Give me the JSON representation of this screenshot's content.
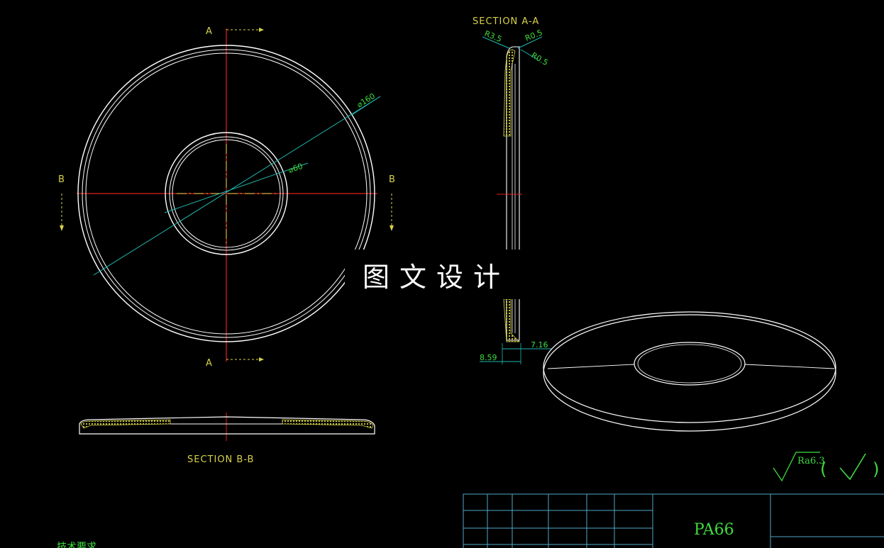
{
  "views": {
    "front": {
      "section_mark_top": "A",
      "section_mark_bottom": "A",
      "section_mark_left": "B",
      "section_mark_right": "B",
      "outer_diameter": "⌀160",
      "inner_diameter": "⌀60"
    },
    "section_bb": {
      "title": "SECTION B-B"
    },
    "section_aa": {
      "title": "SECTION A-A",
      "radius_1": "R3.5",
      "radius_2": "R0.5",
      "radius_3": "R0.5",
      "dim_1": "8.59",
      "dim_2": "7.16"
    }
  },
  "watermark": "图文设计",
  "roughness": {
    "symbol_value": "Ra6.3",
    "paren_open": "(",
    "paren_close": ")"
  },
  "title_block": {
    "material": "PA66"
  },
  "notes": {
    "heading": "技术要求"
  },
  "colors": {
    "outline": "#ffffff",
    "centerline": "#e02020",
    "dimension": "#1fb8b0",
    "dim_text": "#3fdc3f",
    "label": "#d8d24a",
    "hatch": "#d8d24a",
    "table": "#4fa8c8"
  }
}
